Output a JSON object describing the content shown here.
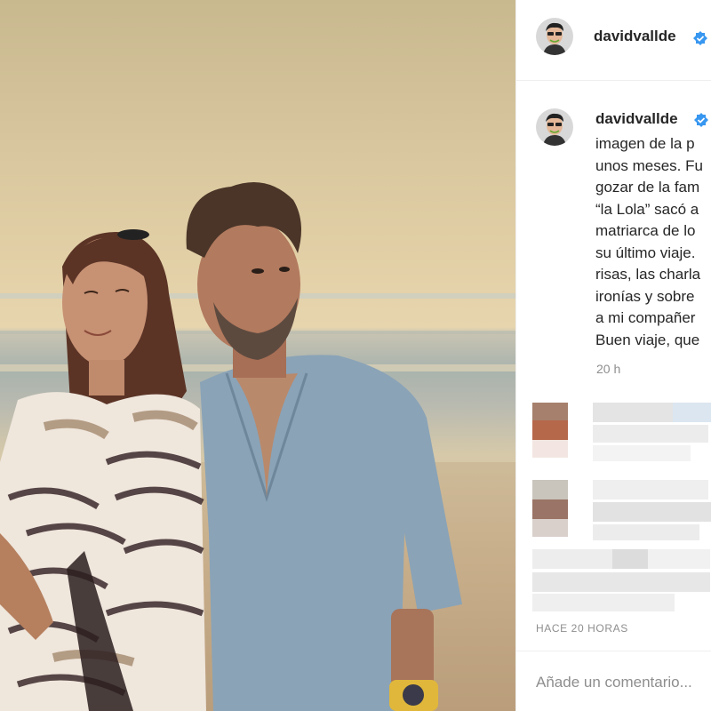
{
  "post": {
    "username": "davidvallde",
    "caption_lines": [
      "imagen de la p",
      "unos meses. Fu",
      "gozar de la fam",
      "“la Lola” sacó a",
      "matriarca de lo",
      "su último viaje.",
      "risas, las charla",
      "ironías y sobre",
      "a mi compañer",
      "Buen viaje, que"
    ],
    "time_ago": "20 h",
    "footer_time": "HACE 20 HORAS",
    "comment_placeholder": "Añade un comentario..."
  },
  "icons": {
    "verified": "verified-badge-icon",
    "avatar": "avatar"
  },
  "colors": {
    "verified_blue": "#3897f0",
    "muted_text": "#8e8e8e",
    "border": "#efefef"
  }
}
